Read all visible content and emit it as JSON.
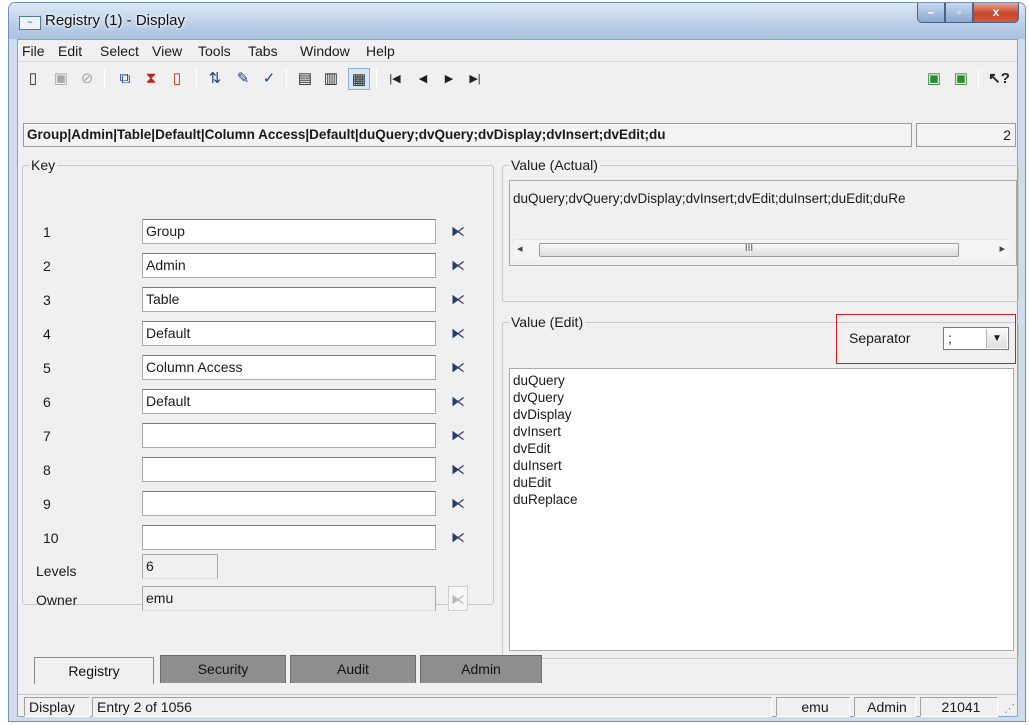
{
  "window": {
    "title": "Registry (1) - Display",
    "app_icon_glyph": "~",
    "controls": {
      "minimize_icon": "minimize-icon",
      "maximize_icon": "maximize-icon",
      "close_icon": "close-icon",
      "minimize": "–",
      "maximize": "▫",
      "close": "x"
    }
  },
  "menu": [
    "File",
    "Edit",
    "Select",
    "View",
    "Tools",
    "Tabs",
    "Window",
    "Help"
  ],
  "toolbar": {
    "icons": [
      "new-document-icon",
      "save-icon",
      "cancel-icon",
      "copy-icon",
      "delete-icon",
      "find-icon",
      "sort-icon",
      "edit-icon",
      "spellcheck-icon",
      "view-list-icon",
      "view-detail-icon",
      "view-grid-icon",
      "first-record-icon",
      "previous-record-icon",
      "next-record-icon",
      "last-record-icon",
      "print-preview-icon",
      "export-icon",
      "context-help-icon"
    ]
  },
  "path": {
    "text": "Group|Admin|Table|Default|Column Access|Default|duQuery;dvQuery;dvDisplay;dvInsert;dvEdit;du",
    "number": "2"
  },
  "key": {
    "label": "Key",
    "rows": [
      {
        "num": "1",
        "value": "Group"
      },
      {
        "num": "2",
        "value": "Admin"
      },
      {
        "num": "3",
        "value": "Table"
      },
      {
        "num": "4",
        "value": "Default"
      },
      {
        "num": "5",
        "value": "Column Access"
      },
      {
        "num": "6",
        "value": "Default"
      },
      {
        "num": "7",
        "value": ""
      },
      {
        "num": "8",
        "value": ""
      },
      {
        "num": "9",
        "value": ""
      },
      {
        "num": "10",
        "value": ""
      }
    ],
    "levels_label": "Levels",
    "levels_value": "6",
    "owner_label": "Owner",
    "owner_value": "emu"
  },
  "value_actual": {
    "label": "Value (Actual)",
    "text": "duQuery;dvQuery;dvDisplay;dvInsert;dvEdit;duInsert;duEdit;duRe",
    "scroll_thumb_glyph": "III"
  },
  "value_edit": {
    "label": "Value (Edit)",
    "separator_label": "Separator",
    "separator_value": ";",
    "lines": [
      "duQuery",
      "dvQuery",
      "dvDisplay",
      "dvInsert",
      "dvEdit",
      "duInsert",
      "duEdit",
      "duReplace"
    ]
  },
  "tabs": [
    "Registry",
    "Security",
    "Audit",
    "Admin"
  ],
  "status": {
    "mode": "Display",
    "entry": "Entry 2 of 1056",
    "user": "emu",
    "group": "Admin",
    "id": "21041"
  },
  "colors": {
    "title_gradient_top": "#dfe9f6",
    "highlight_box": "#d11f1f",
    "tab_inactive": "#8e8e8e"
  }
}
